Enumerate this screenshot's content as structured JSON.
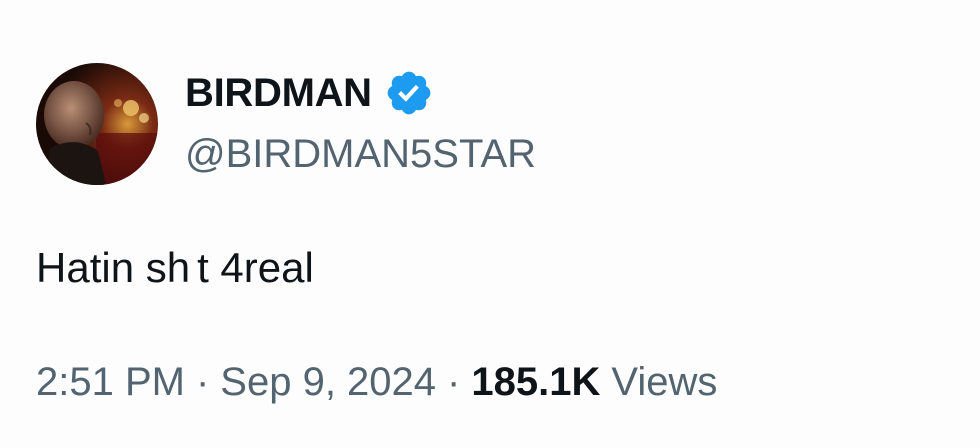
{
  "author": {
    "display_name": "BIRDMAN",
    "handle": "@BIRDMAN5STAR",
    "verified_icon": "verified-badge-icon",
    "verified_color": "#1d9bf0"
  },
  "tweet": {
    "text": "Hatin sh  t 4real"
  },
  "meta": {
    "time": "2:51 PM",
    "separator": "·",
    "date": "Sep 9, 2024",
    "views_count": "185.1K",
    "views_label": "Views"
  }
}
